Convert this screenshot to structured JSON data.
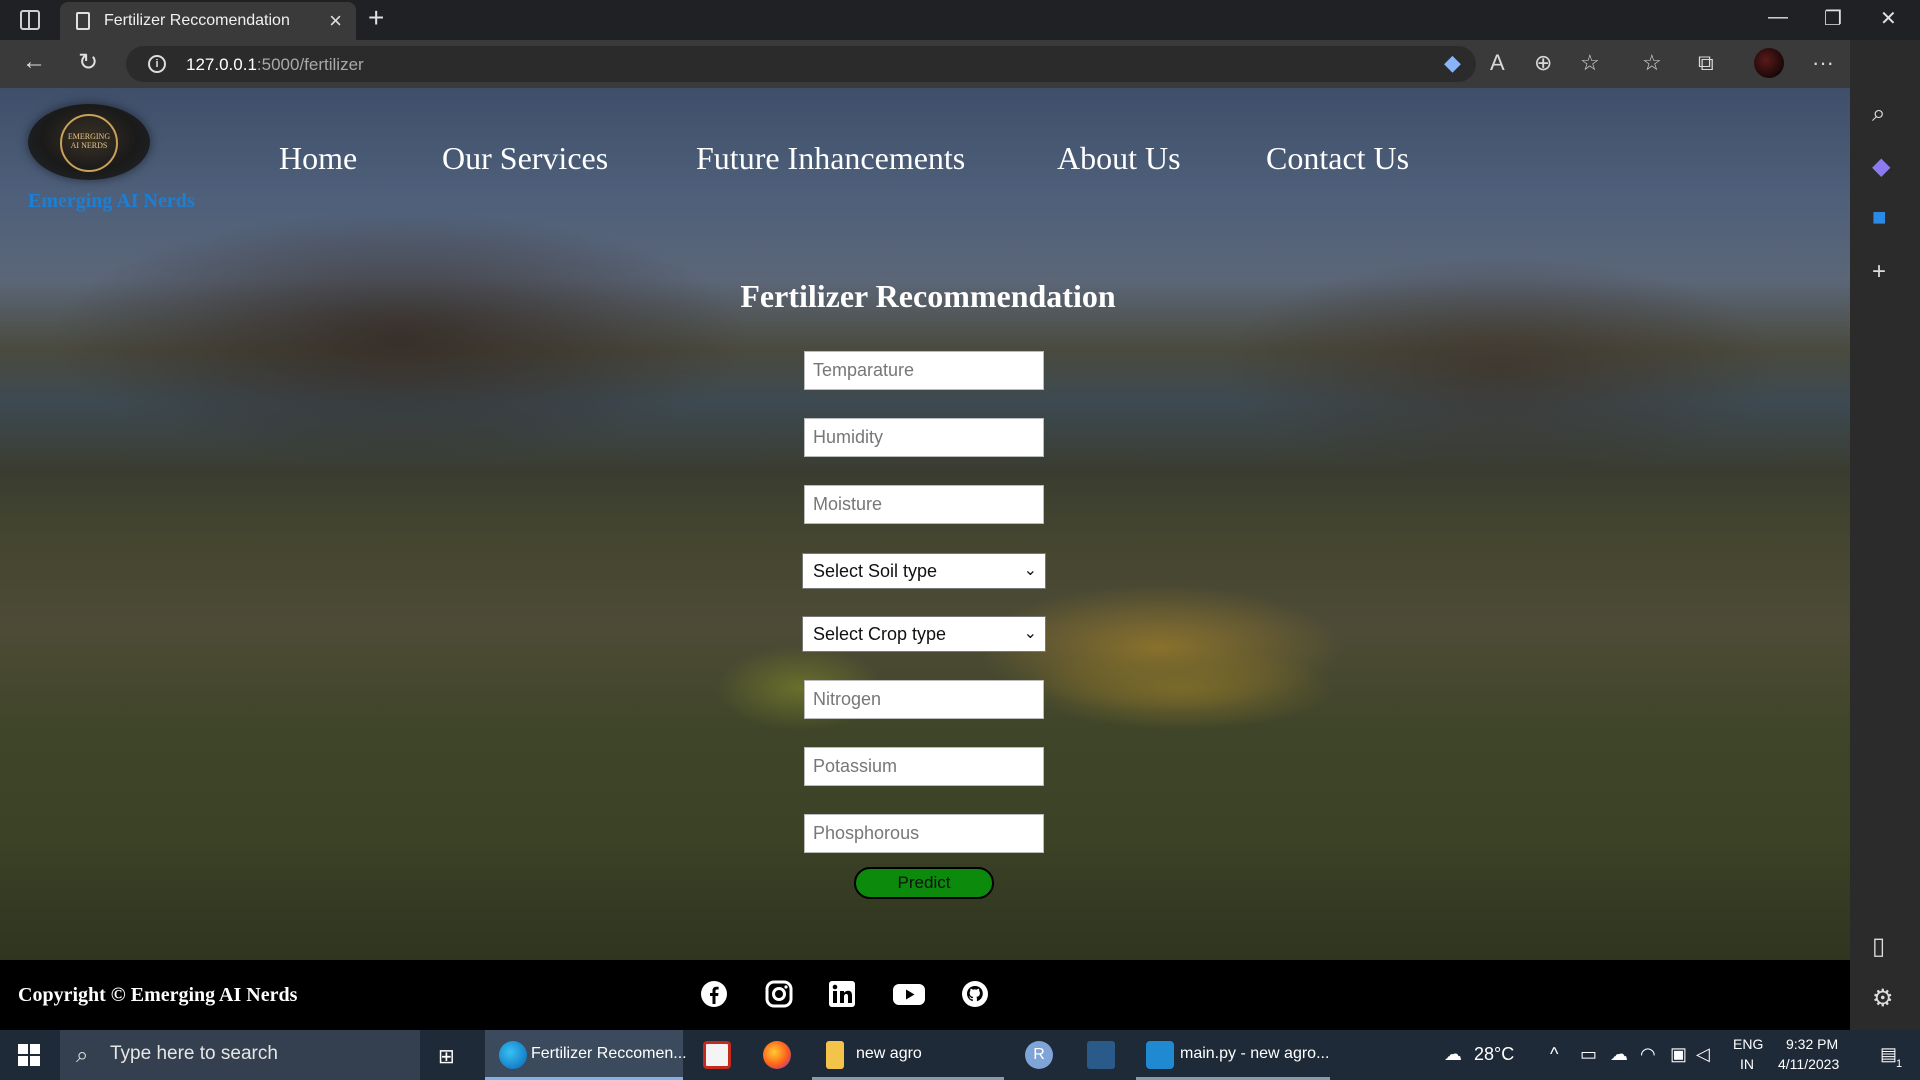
{
  "browser": {
    "tab_title": "Fertilizer Reccomendation",
    "url_host": "127.0.0.1",
    "url_path": ":5000/fertilizer",
    "new_tab": "+",
    "close_tab": "×"
  },
  "site": {
    "logo_text": "EMERGING AI NERDS",
    "brand": "Emerging AI Nerds",
    "menu": [
      "Home",
      "Our Services",
      "Future Inhancements",
      "About Us",
      "Contact Us"
    ]
  },
  "form": {
    "title": "Fertilizer Recommendation",
    "temperature_placeholder": "Temparature",
    "humidity_placeholder": "Humidity",
    "moisture_placeholder": "Moisture",
    "soil_select": "Select Soil type",
    "crop_select": "Select Crop type",
    "nitrogen_placeholder": "Nitrogen",
    "potassium_placeholder": "Potassium",
    "phosphorous_placeholder": "Phosphorous",
    "predict_label": "Predict"
  },
  "footer": {
    "copyright": "Copyright © Emerging AI Nerds",
    "social": [
      "facebook-icon",
      "instagram-icon",
      "linkedin-icon",
      "youtube-icon",
      "github-icon"
    ]
  },
  "taskbar": {
    "search_placeholder": "Type here to search",
    "edge_label": "Fertilizer Reccomen...",
    "folder_label": "new agro",
    "vscode_label": "main.py - new agro...",
    "weather": "28°C",
    "lang": "ENG",
    "region": "IN",
    "time": "9:32 PM",
    "date": "4/11/2023",
    "notif_count": "1",
    "r_app": "R"
  },
  "colors": {
    "brand": "#1c7fd6",
    "predict": "#0b8a0b"
  }
}
